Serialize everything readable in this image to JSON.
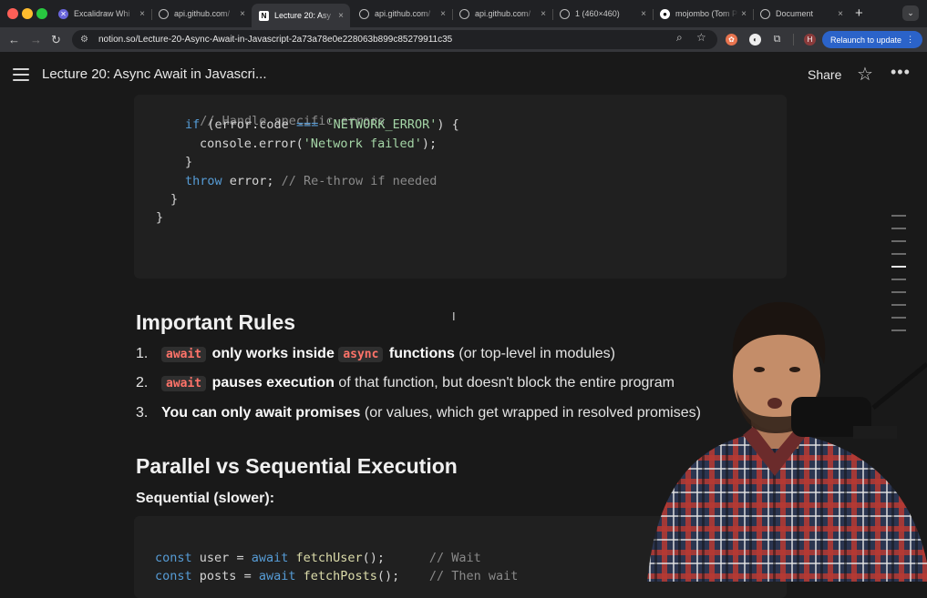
{
  "browser": {
    "tabs": [
      {
        "label": "Excalidraw Whi",
        "favicon": "excalidraw-icon",
        "active": false
      },
      {
        "label": "api.github.com/",
        "favicon": "globe-icon",
        "active": false
      },
      {
        "label": "Lecture 20: Asy",
        "favicon": "notion-icon",
        "active": true
      },
      {
        "label": "api.github.com/",
        "favicon": "globe-icon",
        "active": false
      },
      {
        "label": "api.github.com/",
        "favicon": "globe-icon",
        "active": false
      },
      {
        "label": "1 (460×460)",
        "favicon": "globe-icon",
        "active": false
      },
      {
        "label": "mojombo (Tom P",
        "favicon": "github-icon",
        "active": false
      },
      {
        "label": "Document",
        "favicon": "globe-icon",
        "active": false
      }
    ],
    "url": "notion.so/Lecture-20-Async-Await-in-Javascript-2a73a78e0e228063b899c85279911c35",
    "relaunch_label": "Relaunch to update",
    "profile_initial": "H"
  },
  "header": {
    "title": "Lecture 20: Async Await in Javascri...",
    "share_label": "Share"
  },
  "code_top": {
    "lines": [
      "// Handle specific errors",
      "if (error.code === 'NETWORK_ERROR') {",
      "  console.error('Network failed');",
      "}",
      "throw error; // Re-throw if needed",
      "}",
      "}"
    ]
  },
  "rules": {
    "heading": "Important Rules",
    "items": [
      {
        "num": "1.",
        "code1": "await",
        "bold1": "only works inside",
        "code2": "async",
        "bold2": "functions",
        "rest": "(or top-level in modules)"
      },
      {
        "num": "2.",
        "code1": "await",
        "bold1": "pauses execution",
        "rest": "of that function, but doesn't block the entire program"
      },
      {
        "num": "3.",
        "bold1": "You can only await promises",
        "rest": "(or values, which get wrapped in resolved promises)"
      }
    ]
  },
  "parallel": {
    "heading": "Parallel vs Sequential Execution",
    "subheading": "Sequential (slower):",
    "code": {
      "line1": {
        "kw": "const",
        "var": "user",
        "op": "=",
        "await": "await",
        "fn": "fetchUser",
        "tail": "();",
        "comment": "// Wait"
      },
      "line2": {
        "kw": "const",
        "var": "posts",
        "op": "=",
        "await": "await",
        "fn": "fetchPosts",
        "tail": "();",
        "comment": "// Then wait"
      }
    }
  },
  "colors": {
    "background": "#191919",
    "code_background": "#202020",
    "inline_code": "#ff7369",
    "relaunch": "#2b63c9"
  }
}
